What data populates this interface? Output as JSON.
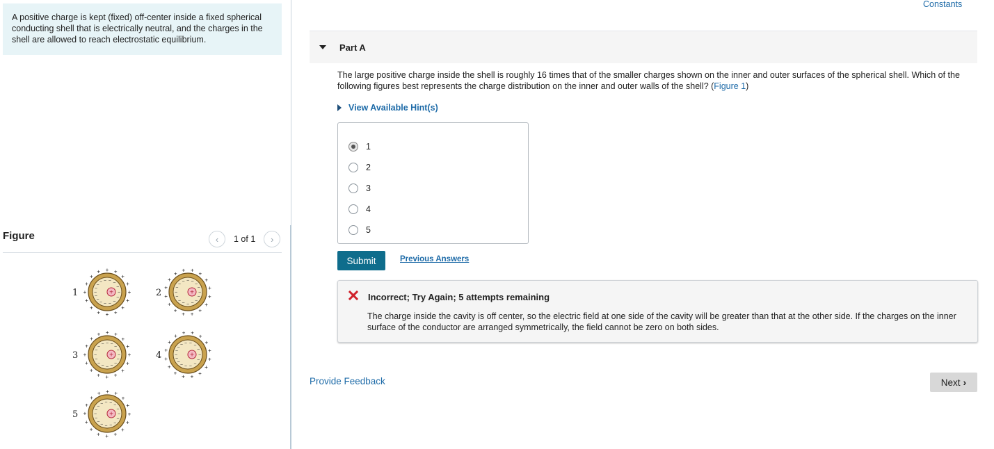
{
  "problem": {
    "text": "A positive charge is kept (fixed) off-center inside a fixed spherical conducting shell that is electrically neutral, and the charges in the shell are allowed to reach electrostatic equilibrium."
  },
  "figure_panel": {
    "title": "Figure",
    "counter": "1 of 1",
    "prev_icon": "chevron-left-icon",
    "next_icon": "chevron-right-icon",
    "option_numbers": [
      "1",
      "2",
      "3",
      "4",
      "5"
    ],
    "plus_sign": "+",
    "minus_sign": "−"
  },
  "header": {
    "constants_link": "Constants"
  },
  "part_a": {
    "title": "Part A",
    "question_text": "The large positive charge inside the shell is roughly 16 times that of the smaller charges shown on the inner and outer surfaces of the spherical shell. Which of the following figures best represents the charge distribution on the inner and outer walls of the shell? (",
    "figure_link": "Figure 1",
    "question_close": ")",
    "hint_label": "View Available Hint(s)",
    "options": [
      {
        "label": "1",
        "selected": true
      },
      {
        "label": "2",
        "selected": false
      },
      {
        "label": "3",
        "selected": false
      },
      {
        "label": "4",
        "selected": false
      },
      {
        "label": "5",
        "selected": false
      }
    ],
    "submit_label": "Submit",
    "previous_answers_label": "Previous Answers",
    "feedback": {
      "title": "Incorrect; Try Again; 5 attempts remaining",
      "body": "The charge inside the cavity is off center, so the electric field at one side of the cavity will be greater than that at the other side. If the charges on the inner surface of the conductor are arranged symmetrically, the field cannot be zero on both sides.",
      "icon": "x-mark-icon",
      "color": "#d0212a"
    }
  },
  "footer": {
    "provide_feedback": "Provide Feedback",
    "next_label": "Next"
  },
  "colors": {
    "accent_link": "#1e6ba8",
    "submit_bg": "#0f6d8c",
    "problem_bg": "#e7f4f7",
    "shell_fill": "#c9a24e",
    "cavity_fill": "#f3e7c3"
  }
}
